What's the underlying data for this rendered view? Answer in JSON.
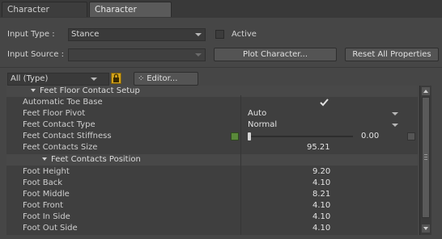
{
  "tabs": [
    {
      "label": "Character Definition"
    },
    {
      "label": "Character Settings"
    }
  ],
  "input_type": {
    "label": "Input Type :",
    "value": "Stance"
  },
  "active": {
    "label": "Active"
  },
  "input_source": {
    "label": "Input Source :",
    "value": ""
  },
  "buttons": {
    "plot": "Plot Character...",
    "reset": "Reset All Properties",
    "editor": "Editor..."
  },
  "filter": {
    "value": "All (Type)"
  },
  "group_top": "Feet Floor Contact Setup",
  "props": {
    "auto_toe": {
      "name": "Automatic Toe Base",
      "checked": true
    },
    "feet_floor_pivot": {
      "name": "Feet Floor Pivot",
      "value": "Auto"
    },
    "feet_contact_type": {
      "name": "Feet Contact Type",
      "value": "Normal"
    },
    "stiffness": {
      "name": "Feet Contact Stiffness",
      "value": "0.00",
      "slider_level": 0.0
    },
    "contacts_size": {
      "name": "Feet Contacts Size",
      "value": "95.21"
    }
  },
  "group_positions": "Feet Contacts Position",
  "positions": [
    {
      "name": "Foot Height",
      "value": "9.20"
    },
    {
      "name": "Foot Back",
      "value": "4.10"
    },
    {
      "name": "Foot Middle",
      "value": "8.21"
    },
    {
      "name": "Foot Front",
      "value": "4.10"
    },
    {
      "name": "Foot In Side",
      "value": "4.10"
    },
    {
      "name": "Foot Out Side",
      "value": "4.10"
    }
  ],
  "colors": {
    "accent_key": "#5a8a3a",
    "lock": "#d2a21a"
  }
}
